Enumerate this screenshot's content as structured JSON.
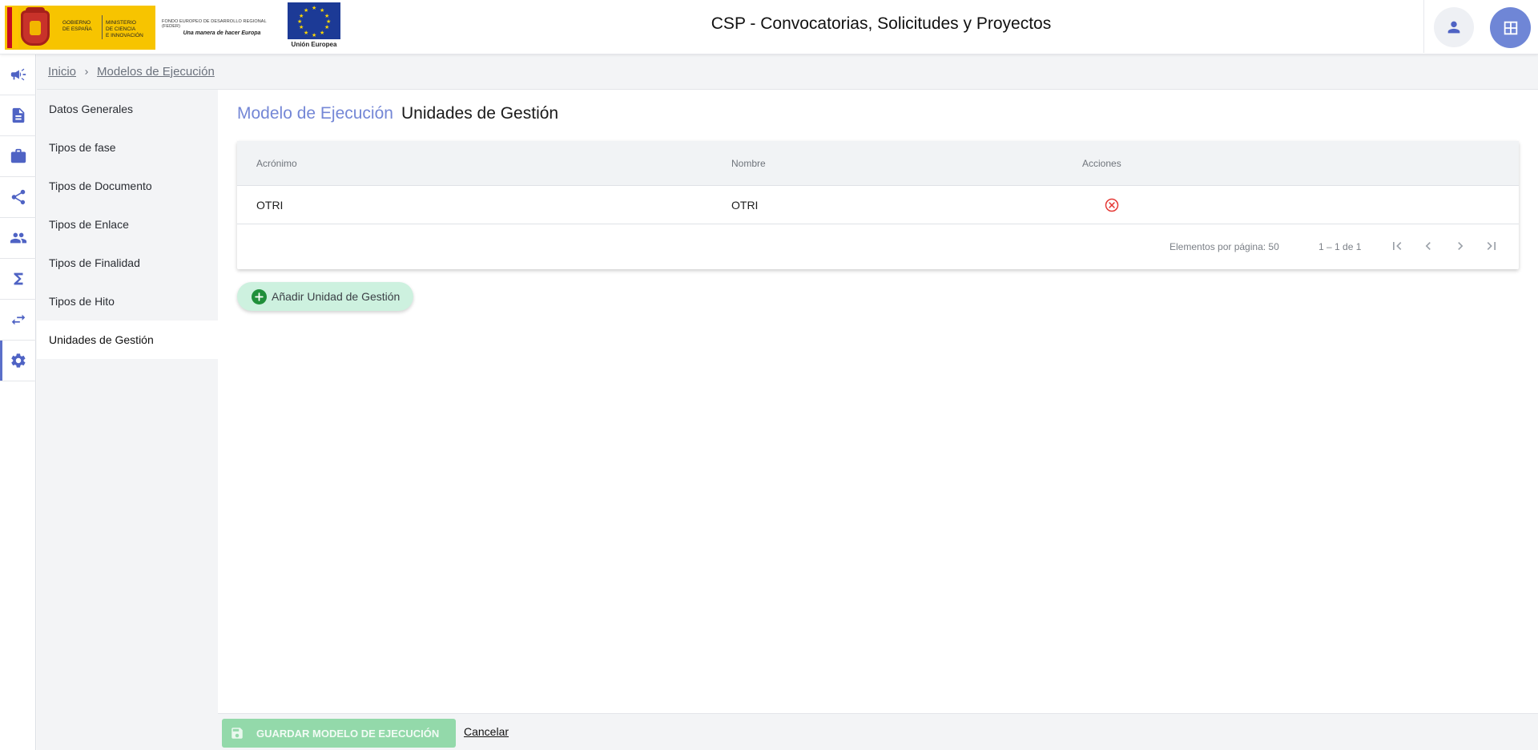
{
  "header": {
    "gov_logo_line1": "GOBIERNO",
    "gov_logo_line2": "DE ESPAÑA",
    "ministry_line1": "MINISTERIO",
    "ministry_line2": "DE CIENCIA",
    "ministry_line3": "E INNOVACIÓN",
    "feder_line1": "FONDO EUROPEO DE DESARROLLO REGIONAL (FEDER)",
    "feder_line2": "Una manera de hacer Europa",
    "eu_label": "Unión Europea",
    "title": "CSP - Convocatorias, Solicitudes y Proyectos",
    "user_icon": "person-icon",
    "apps_icon": "apps-grid-icon"
  },
  "rail": {
    "items": [
      {
        "icon": "megaphone-icon"
      },
      {
        "icon": "document-icon"
      },
      {
        "icon": "briefcase-icon"
      },
      {
        "icon": "share-icon"
      },
      {
        "icon": "people-icon"
      },
      {
        "icon": "sigma-icon"
      },
      {
        "icon": "swap-arrows-icon"
      },
      {
        "icon": "gear-icon",
        "active": true
      }
    ]
  },
  "breadcrumb": {
    "home": "Inicio",
    "current": "Modelos de Ejecución"
  },
  "submenu": {
    "items": [
      {
        "label": "Datos Generales"
      },
      {
        "label": "Tipos de fase"
      },
      {
        "label": "Tipos de Documento"
      },
      {
        "label": "Tipos de Enlace"
      },
      {
        "label": "Tipos de Finalidad"
      },
      {
        "label": "Tipos de Hito"
      },
      {
        "label": "Unidades de Gestión",
        "active": true
      }
    ]
  },
  "page": {
    "prefix": "Modelo de Ejecución",
    "title": "Unidades de Gestión"
  },
  "table": {
    "columns": [
      "Acrónimo",
      "Nombre",
      "Acciones"
    ],
    "rows": [
      {
        "acronimo": "OTRI",
        "nombre": "OTRI",
        "action_icon": "delete-circle-icon"
      }
    ],
    "paginator": {
      "items_per_page_label": "Elementos por página: 50",
      "range": "1 – 1 de 1"
    }
  },
  "actions": {
    "add_label": "Añadir Unidad de Gestión",
    "save_label": "GUARDAR MODELO DE EJECUCIÓN",
    "cancel_label": "Cancelar"
  },
  "colors": {
    "accent": "#5b6fc9",
    "title_prefix": "#7487d6",
    "add_button_bg": "#cdf1df",
    "save_button_bg": "#93d9aa",
    "delete_icon": "#e53935"
  }
}
